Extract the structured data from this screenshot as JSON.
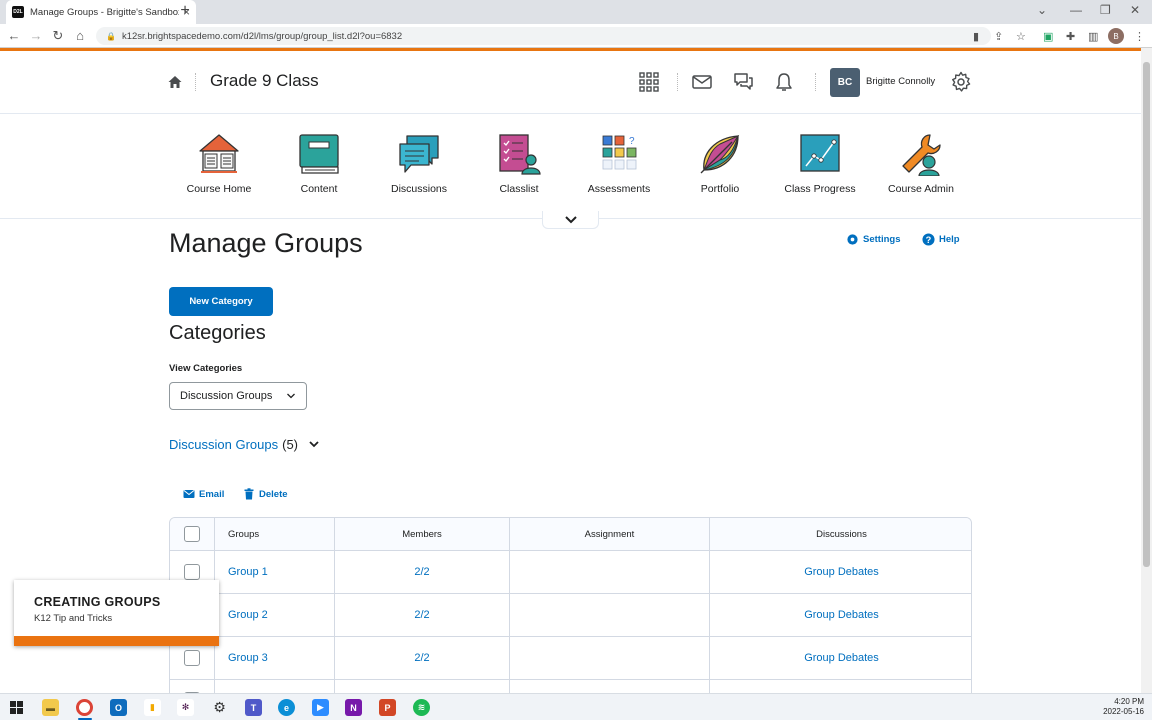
{
  "browser": {
    "tab_title": "Manage Groups - Brigitte's Sandbox",
    "tab_favicon_text": "D2L",
    "url": "k12sr.brightspacedemo.com/d2l/lms/group/group_list.d2l?ou=6832",
    "profile_initial": "B"
  },
  "header": {
    "course_title": "Grade 9 Class",
    "user_initials": "BC",
    "user_name": "Brigitte Connolly"
  },
  "navbar": {
    "items": [
      {
        "label": "Course Home",
        "icon": "book-house-icon"
      },
      {
        "label": "Content",
        "icon": "content-book-icon"
      },
      {
        "label": "Discussions",
        "icon": "discussions-icon"
      },
      {
        "label": "Classlist",
        "icon": "classlist-icon"
      },
      {
        "label": "Assessments",
        "icon": "assessments-icon"
      },
      {
        "label": "Portfolio",
        "icon": "portfolio-icon"
      },
      {
        "label": "Class Progress",
        "icon": "class-progress-icon"
      },
      {
        "label": "Course Admin",
        "icon": "course-admin-icon"
      }
    ]
  },
  "main": {
    "page_title": "Manage Groups",
    "settings_label": "Settings",
    "help_label": "Help",
    "new_category_label": "New Category",
    "categories_title": "Categories",
    "view_categories_label": "View Categories",
    "selected_category": "Discussion Groups",
    "group_heading_name": "Discussion Groups",
    "group_heading_count": "(5)",
    "email_label": "Email",
    "delete_label": "Delete"
  },
  "table": {
    "headers": [
      "Groups",
      "Members",
      "Assignment",
      "Discussions"
    ],
    "rows": [
      {
        "group": "Group 1",
        "members": "2/2",
        "assignment": "",
        "discussions": "Group Debates"
      },
      {
        "group": "Group 2",
        "members": "2/2",
        "assignment": "",
        "discussions": "Group Debates"
      },
      {
        "group": "Group 3",
        "members": "2/2",
        "assignment": "",
        "discussions": "Group Debates"
      }
    ]
  },
  "toast": {
    "title": "CREATING GROUPS",
    "subtitle": "K12 Tip and Tricks"
  },
  "taskbar": {
    "time": "4:20 PM",
    "date": "2022-05-16"
  },
  "colors": {
    "brand_blue": "#006fbf",
    "accent_orange": "#e87511"
  }
}
